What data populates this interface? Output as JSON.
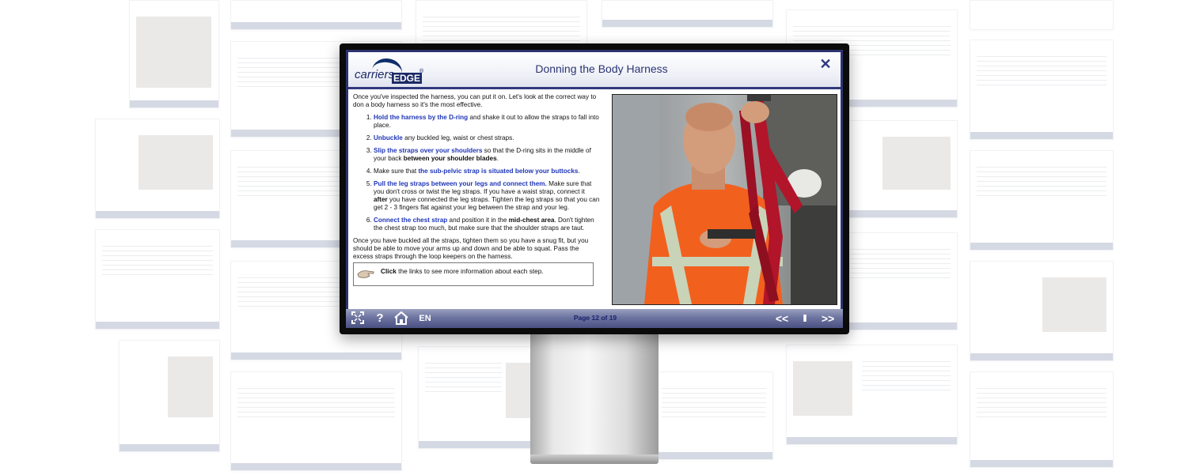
{
  "app": {
    "logo_text_1": "carriers",
    "logo_text_2": "EDGE",
    "logo_registered": "®"
  },
  "slide": {
    "title": "Donning the Body Harness",
    "intro": "Once you've inspected the harness, you can put it on. Let's look at the correct way to don a body harness so it's the most effective.",
    "steps": [
      {
        "bold": "Hold the harness by the D-ring",
        "rest": " and shake it out to allow the straps to fall into place."
      },
      {
        "bold": "Unbuckle",
        "rest": " any buckled leg, waist or chest straps."
      },
      {
        "bold": "Slip the straps over your shoulders",
        "rest": " so that the D-ring sits in the middle of your back ",
        "bold2": "between your shoulder blades",
        "rest2": "."
      },
      {
        "pre": "Make sure that ",
        "bold": "the sub-pelvic strap is situated below your buttocks",
        "rest": "."
      },
      {
        "bold": "Pull the leg straps between your legs and connect them.",
        "rest": " Make sure that you don't cross or twist the leg straps. If you have a waist strap, connect it ",
        "bold2": "after",
        "rest2": " you have connected the leg straps. Tighten the leg straps so that you can get 2 - 3 fingers flat against your leg between the strap and your leg."
      },
      {
        "bold": "Connect the chest strap",
        "rest": " and position it in the ",
        "bold2": "mid-chest area",
        "rest2": ". Don't tighten the chest strap too much, but make sure that the shoulder straps are taut."
      }
    ],
    "outro": "Once you have buckled all the straps, tighten them so you have a snug fit, but you should be able to move your arms up and down and be able to squat. Pass the excess straps through the loop keepers on the harness.",
    "click_bold": "Click",
    "click_rest": " the links to see more information about each step."
  },
  "navbar": {
    "fullscreen_icon": "fullscreen-icon",
    "help_label": "?",
    "home_icon": "home-icon",
    "language_label": "EN",
    "page_label": "Page 12 of 19",
    "prev_label": "<<",
    "pause_label": "II",
    "next_label": ">>"
  },
  "colors": {
    "frame": "#2d3370",
    "title": "#2b3573",
    "link_blue": "#1f36b8"
  }
}
